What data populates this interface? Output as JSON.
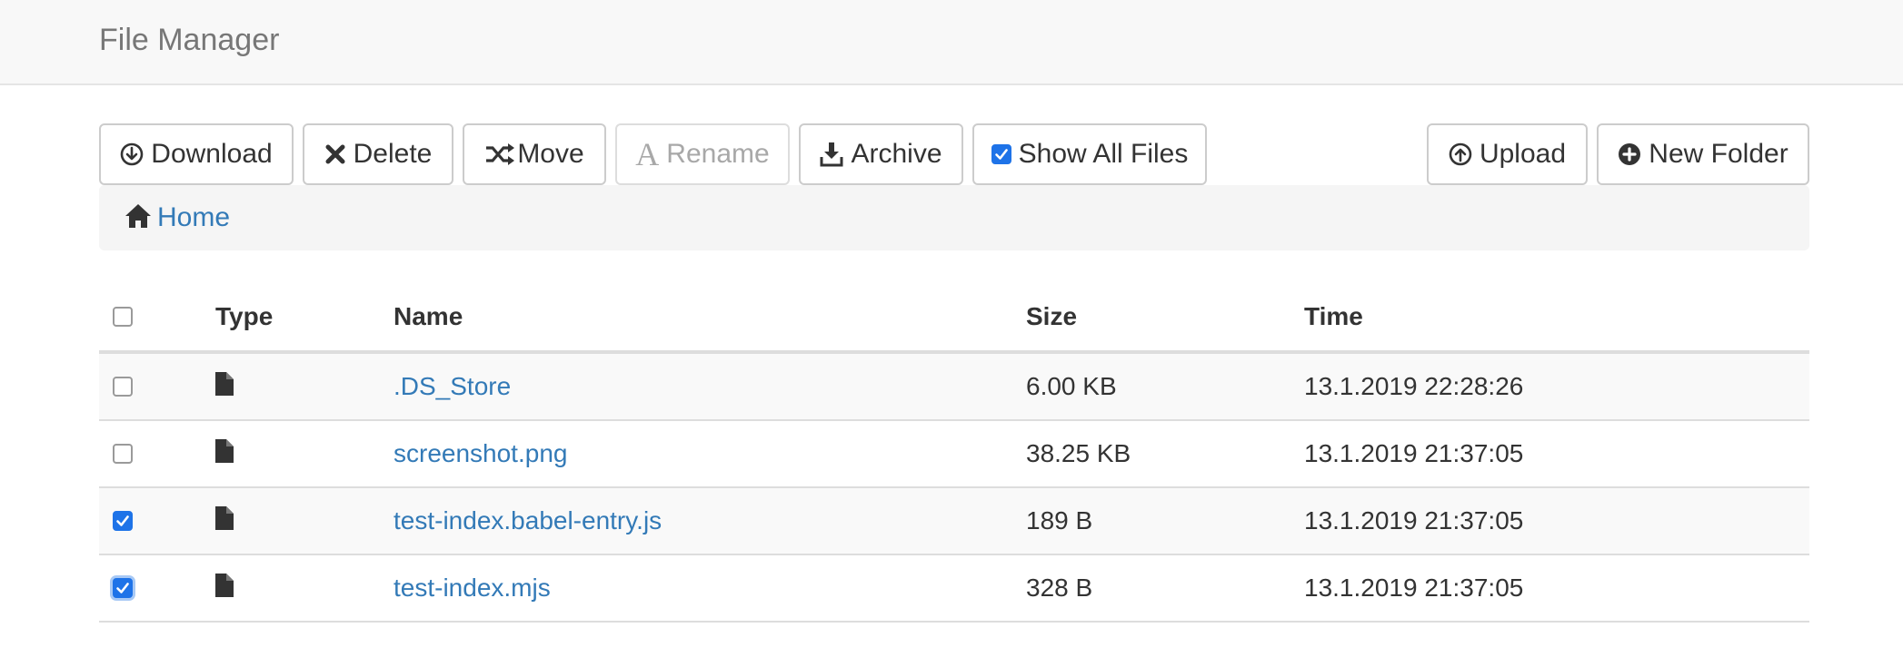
{
  "navbar": {
    "brand": "File Manager"
  },
  "toolbar": {
    "download": "Download",
    "delete": "Delete",
    "move": "Move",
    "rename": "Rename",
    "archive": "Archive",
    "show_all_files": "Show All Files",
    "show_all_files_checked": true,
    "upload": "Upload",
    "new_folder": "New Folder"
  },
  "breadcrumb": {
    "home": "Home"
  },
  "table": {
    "headers": {
      "type": "Type",
      "name": "Name",
      "size": "Size",
      "time": "Time"
    },
    "rows": [
      {
        "name": ".DS_Store",
        "size": "6.00 KB",
        "time": "13.1.2019 22:28:26",
        "selected": false
      },
      {
        "name": "screenshot.png",
        "size": "38.25 KB",
        "time": "13.1.2019 21:37:05",
        "selected": false
      },
      {
        "name": "test-index.babel-entry.js",
        "size": "189 B",
        "time": "13.1.2019 21:37:05",
        "selected": true
      },
      {
        "name": "test-index.mjs",
        "size": "328 B",
        "time": "13.1.2019 21:37:05",
        "selected": true
      }
    ]
  },
  "colors": {
    "link": "#337ab7",
    "accent": "#1e73e8",
    "navbar_bg": "#f8f8f8",
    "stripe": "#f9f9f9"
  }
}
